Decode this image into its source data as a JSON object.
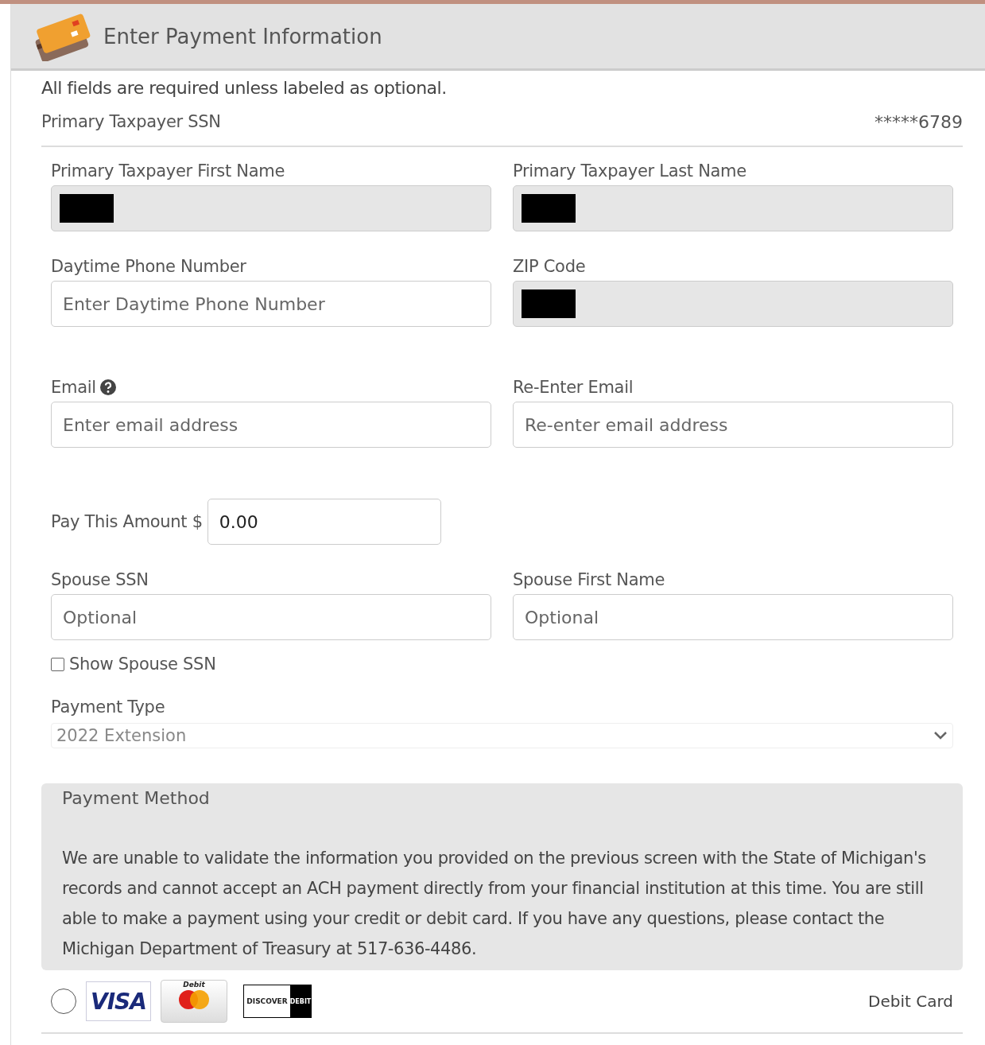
{
  "header": {
    "title": "Enter Payment Information"
  },
  "intro": "All fields are required unless labeled as optional.",
  "ssn": {
    "label": "Primary Taxpayer SSN",
    "value": "*****6789"
  },
  "fields": [
    {
      "label": "Primary Taxpayer First Name",
      "kind": "redacted",
      "readonly": true,
      "help": false
    },
    {
      "label": "Primary Taxpayer Last Name",
      "kind": "redacted",
      "readonly": true,
      "help": false
    },
    {
      "label": "Daytime Phone Number",
      "kind": "input",
      "placeholder": "Enter Daytime Phone Number",
      "readonly": false,
      "help": false
    },
    {
      "label": "ZIP Code",
      "kind": "redacted",
      "readonly": true,
      "help": false
    },
    {
      "label": "Email",
      "kind": "input",
      "placeholder": "Enter email address",
      "readonly": false,
      "help": true
    },
    {
      "label": "Re-Enter Email",
      "kind": "input",
      "placeholder": "Re-enter email address",
      "readonly": false,
      "help": false
    }
  ],
  "amount": {
    "label": "Pay This Amount $",
    "value": "0.00"
  },
  "spouse": [
    {
      "label": "Spouse SSN",
      "placeholder": "Optional"
    },
    {
      "label": "Spouse First Name",
      "placeholder": "Optional"
    }
  ],
  "show_spouse_ssn": {
    "label": "Show Spouse SSN",
    "checked": false
  },
  "payment_type": {
    "label": "Payment Type",
    "value": "2022 Extension",
    "disabled": true
  },
  "payment_method": {
    "title": "Payment Method",
    "message": "We are unable to validate the information you provided on the previous screen with the State of Michigan's records and cannot accept an ACH payment directly from your financial institution at this time. You are still able to make a payment using your credit or debit card. If you have any questions, please contact the Michigan Department of Treasury at 517-636-4486."
  },
  "card_option": {
    "selected": false,
    "visa": "VISA",
    "mastercard": "Debit",
    "discover": "DISCOVER",
    "discover_debit": "DEBIT",
    "label": "Debit Card"
  }
}
